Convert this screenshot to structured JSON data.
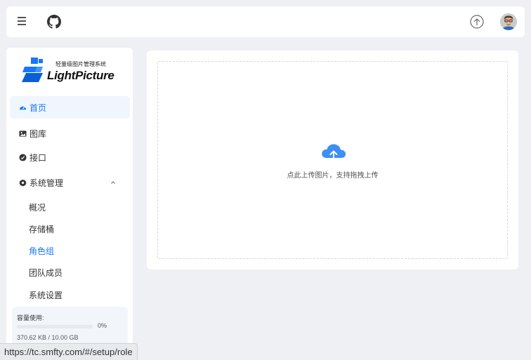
{
  "header": {
    "menu_icon": "hamburger-menu-icon",
    "github_icon": "github-icon",
    "upload_icon": "upload-arrow-circle-icon",
    "avatar_icon": "user-avatar"
  },
  "logo": {
    "subtitle": "轻量级图片管理系统",
    "name": "LightPicture",
    "brand_color": "#1677ff"
  },
  "nav": {
    "home": "首页",
    "gallery": "图库",
    "api": "接口",
    "system": "系统管理",
    "sub_items": {
      "overview": "概况",
      "storage": "存储桶",
      "roles": "角色组",
      "team": "团队成员",
      "settings": "系统设置"
    }
  },
  "storage": {
    "label": "容量使用:",
    "percent_text": "0%",
    "used_fraction": 0.0,
    "size_text": "370.62 KB / 10.00 GB"
  },
  "upload": {
    "hint": "点此上传图片，支持拖拽上传"
  },
  "status_url": "https://tc.smfty.com/#/setup/role",
  "colors": {
    "accent": "#1677ff",
    "active_bg": "#f0f6fd",
    "page_bg": "#eef0f4"
  }
}
